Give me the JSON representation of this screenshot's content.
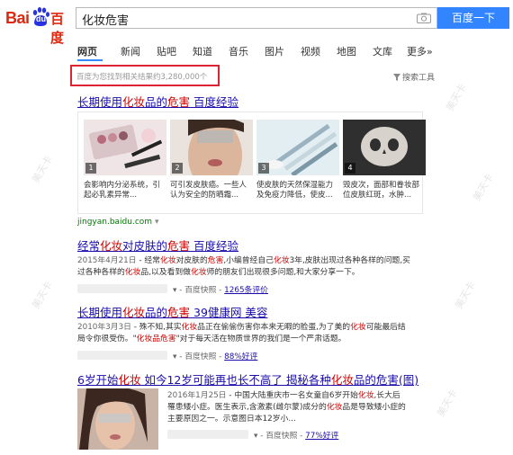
{
  "logo": {
    "bai": "Bai",
    "du": "du",
    "cn": "百度"
  },
  "search": {
    "query": "化妆危害",
    "button_label": "百度一下"
  },
  "tabs": [
    "网页",
    "新闻",
    "贴吧",
    "知道",
    "音乐",
    "图片",
    "视频",
    "地图",
    "文库",
    "更多»"
  ],
  "result_count": "百度为您找到相关结果约3,280,000个",
  "search_tools": "搜索工具",
  "results": [
    {
      "title_pre": "长期使用",
      "title_em1": "化妆",
      "title_mid": "品的",
      "title_em2": "危害",
      "title_post": " 百度经验",
      "images": [
        {
          "num": "1",
          "cap_a": "会影响内分泌系统，引",
          "cap_b": "起必乳素异常..."
        },
        {
          "num": "2",
          "cap_a": "可引发皮肤癌。一些人",
          "cap_b": "认为安全的防晒霜..."
        },
        {
          "num": "3",
          "cap_a": "使皮肤的天然保湿能力",
          "cap_b": "及免疫力降低，使皮..."
        },
        {
          "num": "4",
          "cap_a": "毁皮次，面部和眷妆部",
          "cap_b": "位皮肤红斑，水肿..."
        }
      ],
      "host": "jingyan.baidu.com"
    },
    {
      "title_pre": "经常",
      "title_em1": "化妆",
      "title_mid": "对皮肤的",
      "title_em2": "危害",
      "title_post": " 百度经验",
      "date": "2015年4月21日",
      "line1_a": " - 经常",
      "line1_em1": "化妆",
      "line1_b": "对皮肤的",
      "line1_em2": "危害",
      "line1_c": ",小编曾经自己",
      "line1_em3": "化妆",
      "line1_d": "3年,皮肤出现过各种各样的问题,买",
      "line2_a": "过各种各样的",
      "line2_em1": "化妆",
      "line2_b": "品,以及看到做",
      "line2_em2": "化妆",
      "line2_c": "师的朋友们出现很多问题,和大家分享一下。",
      "snapshot": "百度快照",
      "reviews": "1265条评价"
    },
    {
      "title_pre": "长期使用",
      "title_em1": "化妆",
      "title_mid": "品的",
      "title_em2": "危害",
      "title_post": " 39健康网 美容",
      "date": "2010年3月3日",
      "line1_a": " - 殊不知,其实",
      "line1_em1": "化妆",
      "line1_b": "品正在偷偷伤害你本来无暇的脸蛋,为了美的",
      "line1_em2": "化妆",
      "line1_c": "可能最后结",
      "line2_a": "局令你很受伤。\"",
      "line2_em1": "化妆品危害",
      "line2_b": "\"对于每天活在物质世界的我们是一个严肃话题。",
      "snapshot": "百度快照",
      "reviews": "88%好评"
    },
    {
      "title_pre": "6岁开始",
      "title_em1": "化妆",
      "title_mid": " 如今12岁可能再也长不高了 揭秘各种",
      "title_em2": "化妆",
      "title_post": "品的危害(图)",
      "date": "2016年1月25日",
      "line1_a": " - 中国大陆重庆市一名女童自6岁开始",
      "line1_em1": "化妆",
      "line1_b": ",长大后",
      "line2_a": "罹患矮小症。医生表示,含激素(雌尔蒙)成分的",
      "line2_em1": "化妆",
      "line2_b": "品是导致矮小症的",
      "line3": "主要原因之一。示意图日本12岁小...",
      "snapshot": "百度快照",
      "reviews": "77%好评"
    }
  ],
  "watermark": "美天卡",
  "colors": {
    "link": "#1a0dab",
    "highlight": "#c00",
    "url_green": "#070",
    "button": "#3385ff",
    "box_red": "#d23"
  }
}
